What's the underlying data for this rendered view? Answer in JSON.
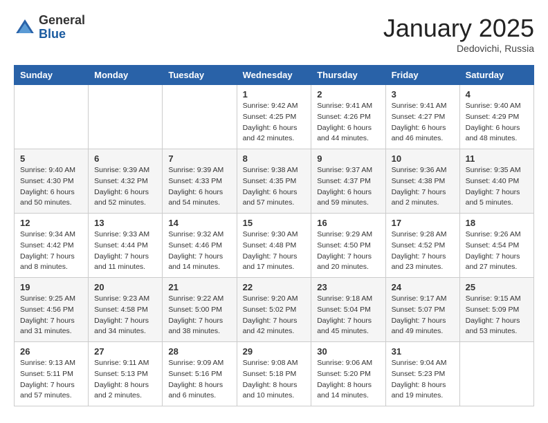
{
  "header": {
    "logo_general": "General",
    "logo_blue": "Blue",
    "month_title": "January 2025",
    "location": "Dedovichi, Russia"
  },
  "weekdays": [
    "Sunday",
    "Monday",
    "Tuesday",
    "Wednesday",
    "Thursday",
    "Friday",
    "Saturday"
  ],
  "weeks": [
    [
      {
        "day": "",
        "info": ""
      },
      {
        "day": "",
        "info": ""
      },
      {
        "day": "",
        "info": ""
      },
      {
        "day": "1",
        "info": "Sunrise: 9:42 AM\nSunset: 4:25 PM\nDaylight: 6 hours and 42 minutes."
      },
      {
        "day": "2",
        "info": "Sunrise: 9:41 AM\nSunset: 4:26 PM\nDaylight: 6 hours and 44 minutes."
      },
      {
        "day": "3",
        "info": "Sunrise: 9:41 AM\nSunset: 4:27 PM\nDaylight: 6 hours and 46 minutes."
      },
      {
        "day": "4",
        "info": "Sunrise: 9:40 AM\nSunset: 4:29 PM\nDaylight: 6 hours and 48 minutes."
      }
    ],
    [
      {
        "day": "5",
        "info": "Sunrise: 9:40 AM\nSunset: 4:30 PM\nDaylight: 6 hours and 50 minutes."
      },
      {
        "day": "6",
        "info": "Sunrise: 9:39 AM\nSunset: 4:32 PM\nDaylight: 6 hours and 52 minutes."
      },
      {
        "day": "7",
        "info": "Sunrise: 9:39 AM\nSunset: 4:33 PM\nDaylight: 6 hours and 54 minutes."
      },
      {
        "day": "8",
        "info": "Sunrise: 9:38 AM\nSunset: 4:35 PM\nDaylight: 6 hours and 57 minutes."
      },
      {
        "day": "9",
        "info": "Sunrise: 9:37 AM\nSunset: 4:37 PM\nDaylight: 6 hours and 59 minutes."
      },
      {
        "day": "10",
        "info": "Sunrise: 9:36 AM\nSunset: 4:38 PM\nDaylight: 7 hours and 2 minutes."
      },
      {
        "day": "11",
        "info": "Sunrise: 9:35 AM\nSunset: 4:40 PM\nDaylight: 7 hours and 5 minutes."
      }
    ],
    [
      {
        "day": "12",
        "info": "Sunrise: 9:34 AM\nSunset: 4:42 PM\nDaylight: 7 hours and 8 minutes."
      },
      {
        "day": "13",
        "info": "Sunrise: 9:33 AM\nSunset: 4:44 PM\nDaylight: 7 hours and 11 minutes."
      },
      {
        "day": "14",
        "info": "Sunrise: 9:32 AM\nSunset: 4:46 PM\nDaylight: 7 hours and 14 minutes."
      },
      {
        "day": "15",
        "info": "Sunrise: 9:30 AM\nSunset: 4:48 PM\nDaylight: 7 hours and 17 minutes."
      },
      {
        "day": "16",
        "info": "Sunrise: 9:29 AM\nSunset: 4:50 PM\nDaylight: 7 hours and 20 minutes."
      },
      {
        "day": "17",
        "info": "Sunrise: 9:28 AM\nSunset: 4:52 PM\nDaylight: 7 hours and 23 minutes."
      },
      {
        "day": "18",
        "info": "Sunrise: 9:26 AM\nSunset: 4:54 PM\nDaylight: 7 hours and 27 minutes."
      }
    ],
    [
      {
        "day": "19",
        "info": "Sunrise: 9:25 AM\nSunset: 4:56 PM\nDaylight: 7 hours and 31 minutes."
      },
      {
        "day": "20",
        "info": "Sunrise: 9:23 AM\nSunset: 4:58 PM\nDaylight: 7 hours and 34 minutes."
      },
      {
        "day": "21",
        "info": "Sunrise: 9:22 AM\nSunset: 5:00 PM\nDaylight: 7 hours and 38 minutes."
      },
      {
        "day": "22",
        "info": "Sunrise: 9:20 AM\nSunset: 5:02 PM\nDaylight: 7 hours and 42 minutes."
      },
      {
        "day": "23",
        "info": "Sunrise: 9:18 AM\nSunset: 5:04 PM\nDaylight: 7 hours and 45 minutes."
      },
      {
        "day": "24",
        "info": "Sunrise: 9:17 AM\nSunset: 5:07 PM\nDaylight: 7 hours and 49 minutes."
      },
      {
        "day": "25",
        "info": "Sunrise: 9:15 AM\nSunset: 5:09 PM\nDaylight: 7 hours and 53 minutes."
      }
    ],
    [
      {
        "day": "26",
        "info": "Sunrise: 9:13 AM\nSunset: 5:11 PM\nDaylight: 7 hours and 57 minutes."
      },
      {
        "day": "27",
        "info": "Sunrise: 9:11 AM\nSunset: 5:13 PM\nDaylight: 8 hours and 2 minutes."
      },
      {
        "day": "28",
        "info": "Sunrise: 9:09 AM\nSunset: 5:16 PM\nDaylight: 8 hours and 6 minutes."
      },
      {
        "day": "29",
        "info": "Sunrise: 9:08 AM\nSunset: 5:18 PM\nDaylight: 8 hours and 10 minutes."
      },
      {
        "day": "30",
        "info": "Sunrise: 9:06 AM\nSunset: 5:20 PM\nDaylight: 8 hours and 14 minutes."
      },
      {
        "day": "31",
        "info": "Sunrise: 9:04 AM\nSunset: 5:23 PM\nDaylight: 8 hours and 19 minutes."
      },
      {
        "day": "",
        "info": ""
      }
    ]
  ]
}
